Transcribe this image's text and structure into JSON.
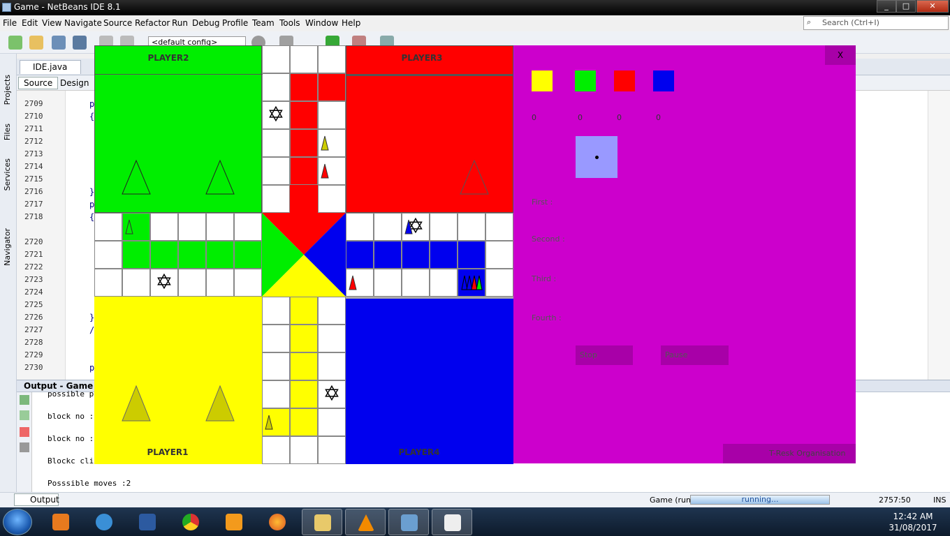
{
  "window": {
    "title": "Game - NetBeans IDE 8.1",
    "min": "_",
    "max": "□",
    "close": "✕"
  },
  "menu": [
    "File",
    "Edit",
    "View",
    "Navigate",
    "Source",
    "Refactor",
    "Run",
    "Debug",
    "Profile",
    "Team",
    "Tools",
    "Window",
    "Help"
  ],
  "search": {
    "placeholder": "Search (Ctrl+I)"
  },
  "toolbar": {
    "config": "<default config>"
  },
  "sidebar": {
    "projects": "Projects",
    "files": "Files",
    "services": "Services",
    "navigator": "Navigator"
  },
  "editor": {
    "tab": "IDE.java",
    "source_tab": "Source",
    "design_tab": "Design",
    "line_numbers": [
      "2709",
      "2710",
      "2711",
      "2712",
      "2713",
      "2714",
      "2715",
      "2716",
      "2717",
      "2718",
      "",
      "2720",
      "2721",
      "2722",
      "2723",
      "2724",
      "2725",
      "2726",
      "2727",
      "2728",
      "2729",
      "2730"
    ],
    "code": [
      {
        "line": "2709",
        "text": "p"
      },
      {
        "line": "2710",
        "text": "{"
      },
      {
        "line": "2716",
        "text": "}"
      },
      {
        "line": "2717",
        "text": "p"
      },
      {
        "line": "2718",
        "text": "{"
      },
      {
        "line": "2726",
        "text": "}"
      },
      {
        "line": "2727",
        "text": "/"
      },
      {
        "line": "2730",
        "text": "p"
      }
    ]
  },
  "output": {
    "title": "Output - Game (run)",
    "lines": [
      "possible p",
      "block no :",
      "block no :",
      "Blockc cli",
      "Posssible moves :2"
    ]
  },
  "statusbar": {
    "output_tab": "Output",
    "process": "Game (run)",
    "progress_text": "running...",
    "position": "2757:50",
    "mode": "INS"
  },
  "taskbar": {
    "time": "12:42 AM",
    "date": "31/08/2017"
  },
  "game": {
    "players": {
      "p1": "PLAYER1",
      "p2": "PLAYER2",
      "p3": "PLAYER3",
      "p4": "PLAYER4"
    },
    "colors": {
      "yellow": "#ffff00",
      "green": "#00ee00",
      "red": "#ff0000",
      "blue": "#0000ee",
      "panel": "#cc00cc"
    },
    "scores": [
      "0",
      "0",
      "0",
      "0"
    ],
    "rank_labels": {
      "first": "First  :",
      "second": "Second :",
      "third": "Third  :",
      "fourth": "Fourth :"
    },
    "buttons": {
      "stop": "Stop",
      "pause": "Pause",
      "close": "X"
    },
    "footer": "T-Resk Organisation",
    "star_glyph": "✡"
  }
}
